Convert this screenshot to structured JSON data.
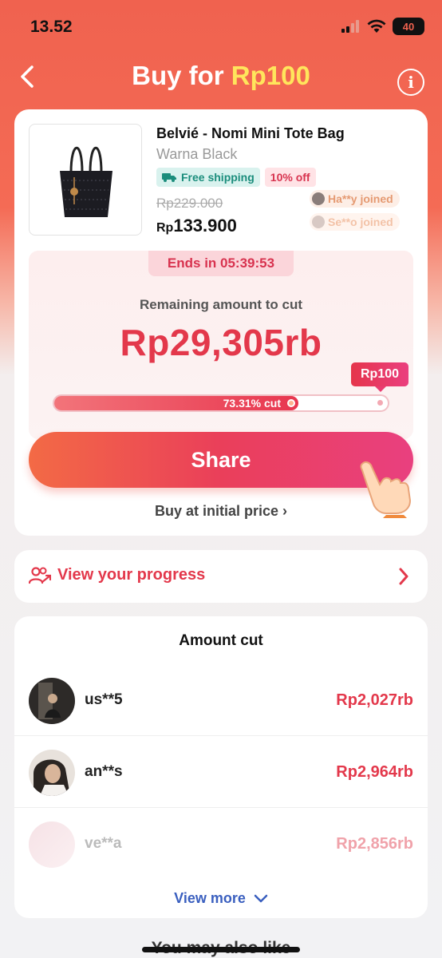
{
  "status": {
    "time": "13.52",
    "battery": "40"
  },
  "header": {
    "title_prefix": "Buy for ",
    "title_price": "Rp100"
  },
  "product": {
    "name": "Belvié - Nomi Mini Tote Bag",
    "variant": "Warna  Black",
    "free_shipping": "Free shipping",
    "discount": "10% off",
    "old_price": "Rp229.000",
    "price_currency": "Rp",
    "price_amount": "133.900",
    "joined": [
      "Ha**y joined",
      "Se**o joined"
    ]
  },
  "cut": {
    "ends_in": "Ends in 05:39:53",
    "remaining_label": "Remaining amount to cut",
    "remaining_amount": "Rp29,305rb",
    "target": "Rp100",
    "progress_label": "73.31% cut",
    "progress_fraction": 0.7331
  },
  "actions": {
    "share": "Share",
    "buy_initial": "Buy at initial price"
  },
  "progress_link": "View your progress",
  "amount_cut": {
    "title": "Amount cut",
    "rows": [
      {
        "user": "us**5",
        "amount": "Rp2,027rb"
      },
      {
        "user": "an**s",
        "amount": "Rp2,964rb"
      },
      {
        "user": "ve**a",
        "amount": "Rp2,856rb"
      }
    ],
    "view_more": "View more"
  },
  "footer": {
    "also_like": "You may also like"
  },
  "colors": {
    "accent": "#e3384b",
    "header_bg": "#f0624f",
    "title_highlight": "#ffe55c",
    "link": "#3a5fbf"
  }
}
